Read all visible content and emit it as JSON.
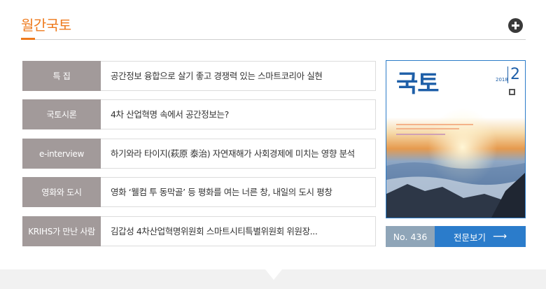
{
  "header": {
    "title": "월간국토",
    "more_icon": "plus-circle-icon"
  },
  "articles": [
    {
      "category": "특 집",
      "title": "공간정보 융합으로 살기 좋고 경쟁력 있는 스마트코리아 실현"
    },
    {
      "category": "국토시론",
      "title": "4차 산업혁명 속에서 공간정보는?"
    },
    {
      "category": "e-interview",
      "title": "하기와라 타이지(萩原 泰治) 자연재해가 사회경제에 미치는 영향 분석"
    },
    {
      "category": "영화와 도시",
      "title": "영화 ‘웰컴 투 동막골’ 등 평화를 여는 너른 창, 내일의 도시 평창"
    },
    {
      "category": "KRIHS가 만난 사람",
      "title": "김갑성 4차산업혁명위원회 스마트시티특별위원회 위원장..."
    }
  ],
  "magazine": {
    "logo": "국토",
    "year": "2018",
    "month": "2",
    "cover_caption": "공간정보 융합으로 살기 좋고 경쟁력 있는 스마트코리아 실현",
    "issue_label": "No. 436",
    "view_full_label": "전문보기",
    "view_full_icon": "arrow-right-icon"
  },
  "colors": {
    "accent": "#ee7a1d",
    "category_bg": "#a29a9a",
    "button_blue": "#2b7ccb",
    "issue_bg": "#8fa5b8"
  }
}
